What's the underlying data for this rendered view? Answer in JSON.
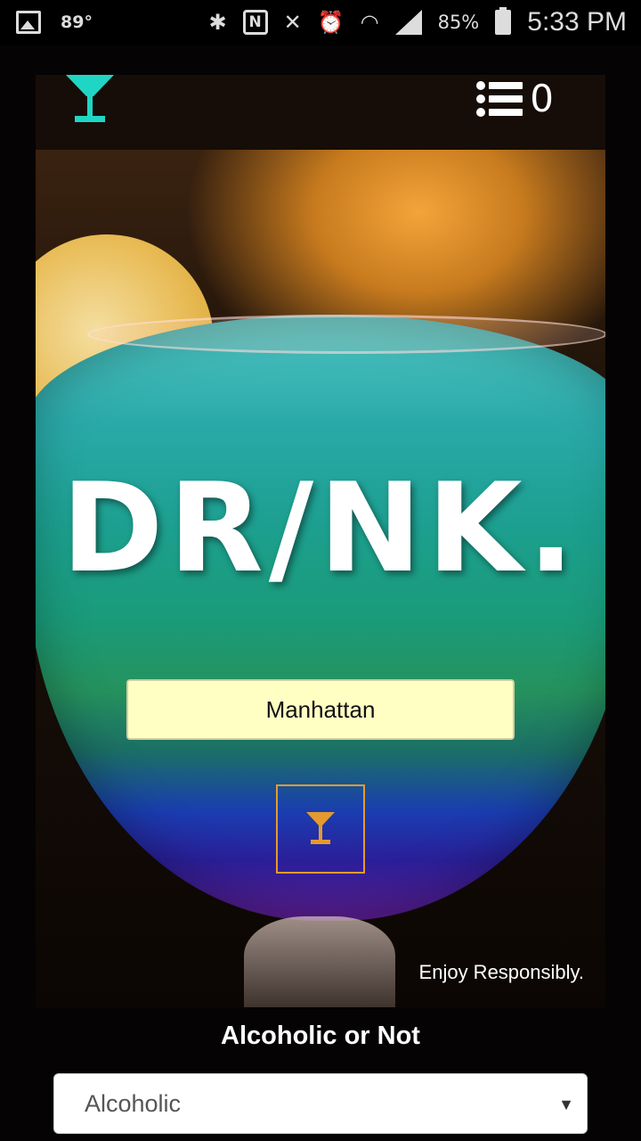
{
  "status_bar": {
    "temperature": "89°",
    "battery_percent": "85%",
    "time": "5:33 PM",
    "icons": [
      "gallery-icon",
      "bluetooth-icon",
      "nfc-icon",
      "mute-icon",
      "alarm-icon",
      "wifi-icon",
      "signal-icon",
      "battery-icon"
    ]
  },
  "navbar": {
    "brand_icon": "martini-glass-icon",
    "brand_color": "#1fd6c4",
    "list_icon": "list-icon",
    "list_count": "0"
  },
  "hero": {
    "logo_text": "DR/NK.",
    "search_value": "Manhattan",
    "search_button_icon": "martini-glass-icon",
    "button_color": "#e59a2d",
    "tagline": "Enjoy Responsibly."
  },
  "filter": {
    "label": "Alcoholic or Not",
    "selected": "Alcoholic"
  }
}
